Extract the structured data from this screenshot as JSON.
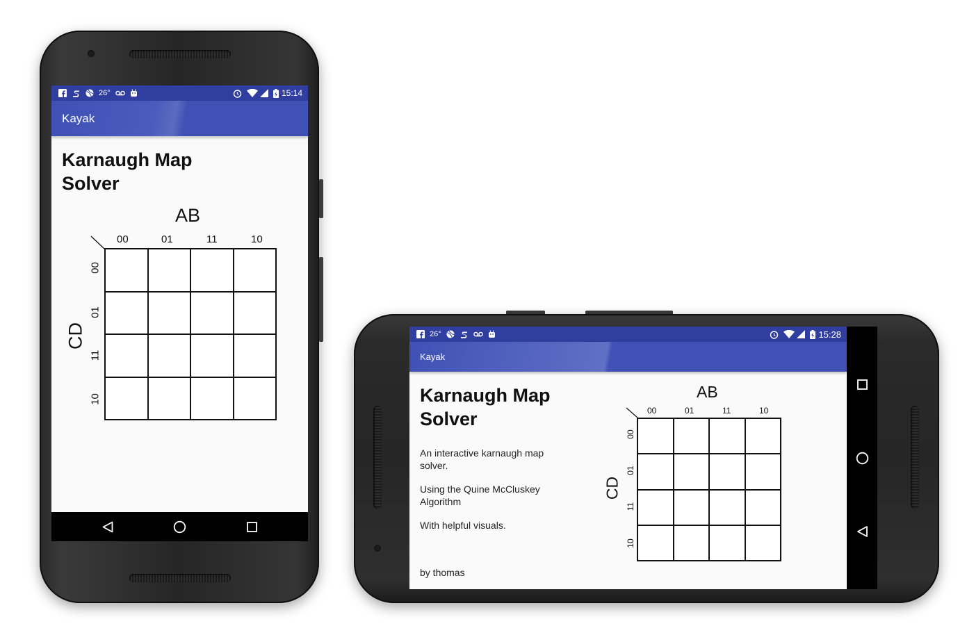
{
  "app": {
    "title": "Kayak",
    "heading": "Karnaugh Map Solver",
    "heading_line1": "Karnaugh Map",
    "heading_line2": "Solver",
    "description_1": "An interactive karnaugh map solver.",
    "description_2": "Using the Quine McCluskey Algorithm",
    "description_3": "With helpful visuals.",
    "author": "by thomas",
    "colors": {
      "primary": "#3f51b5",
      "primary_dark": "#303f9f",
      "background": "#fafafa"
    }
  },
  "kmap": {
    "column_variable": "AB",
    "row_variable": "CD",
    "column_labels": [
      "00",
      "01",
      "11",
      "10"
    ],
    "row_labels": [
      "00",
      "01",
      "11",
      "10"
    ]
  },
  "portrait": {
    "status": {
      "temperature": "26°",
      "time": "15:14",
      "left_icons": [
        "facebook-icon",
        "s-icon",
        "ball-icon",
        "voicemail-icon",
        "android-icon"
      ],
      "right_icons": [
        "alarm-icon",
        "wifi-icon",
        "signal-icon",
        "battery-charging-icon"
      ]
    },
    "nav": [
      "back-icon",
      "home-icon",
      "recents-icon"
    ]
  },
  "landscape": {
    "status": {
      "temperature": "26°",
      "time": "15:28",
      "left_icons": [
        "facebook-icon",
        "ball-icon",
        "s-icon",
        "voicemail-icon",
        "android-icon"
      ],
      "right_icons": [
        "alarm-icon",
        "wifi-icon",
        "signal-icon",
        "battery-charging-icon"
      ]
    },
    "nav": [
      "recents-icon",
      "home-icon",
      "back-icon"
    ]
  }
}
